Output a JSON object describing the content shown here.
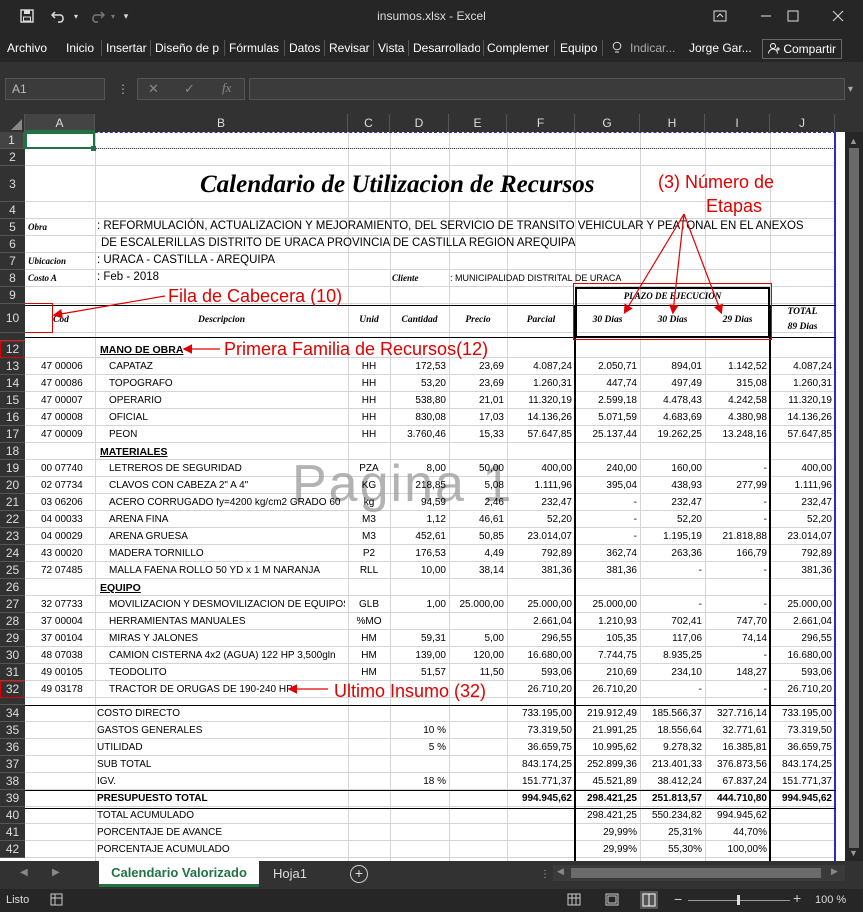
{
  "window": {
    "title": "insumos.xlsx - Excel",
    "user": "Jorge Gar...",
    "share": "Compartir"
  },
  "menu": [
    "Archivo",
    "Inicio",
    "Insertar",
    "Diseño de p",
    "Fórmulas",
    "Datos",
    "Revisar",
    "Vista",
    "Desarrollado",
    "Complemer",
    "Equipo",
    "Indicar..."
  ],
  "namebox": "A1",
  "fx": "fx",
  "columns": [
    "A",
    "B",
    "C",
    "D",
    "E",
    "F",
    "G",
    "H",
    "I",
    "J"
  ],
  "rows": [
    "1",
    "2",
    "3",
    "4",
    "5",
    "6",
    "7",
    "8",
    "9",
    "10",
    "12",
    "13",
    "14",
    "15",
    "16",
    "17",
    "18",
    "19",
    "20",
    "21",
    "22",
    "23",
    "24",
    "25",
    "26",
    "27",
    "28",
    "29",
    "30",
    "31",
    "32",
    "34",
    "35",
    "36",
    "37",
    "38",
    "39",
    "40",
    "41",
    "42"
  ],
  "sheet": {
    "title": "Calendario de Utilizacion de Recursos",
    "obra_label": "Obra",
    "obra_1": ": REFORMULACIÓN, ACTUALIZACION Y MEJORAMIENTO,  DEL SERVICIO  DE TRANSITO VEHICULAR  Y PEATONAL EN EL ANEXOS",
    "obra_2": "DE ESCALERILLAS DISTRITO DE  URACA       PROVINCIA DE CASTILLA  REGION AREQUIPA",
    "ubic_label": "Ubicacion",
    "ubic": ": URACA - CASTILLA - AREQUIPA",
    "costo_label": "Costo A",
    "costo": ": Feb - 2018",
    "cliente_label": "Cliente",
    "cliente": ": MUNICIPALIDAD DISTRITAL DE URACA",
    "plazo": "PLAZO DE EJECUCION",
    "h_cod": "Cod",
    "h_desc": "Descripcion",
    "h_unid": "Unid",
    "h_cant": "Cantidad",
    "h_precio": "Precio",
    "h_parcial": "Parcial",
    "h_g": "30 Dias",
    "h_h": "30 Dias",
    "h_i": "29 Dias",
    "h_total_1": "TOTAL",
    "h_total_2": "89 Dias",
    "watermark": "Pagina 1"
  },
  "data_rows": [
    {
      "row": "12",
      "b": "MANO DE OBRA",
      "section": true
    },
    {
      "row": "13",
      "a": "47 00006",
      "b": "CAPATAZ",
      "c": "HH",
      "d": "172,53",
      "e": "23,69",
      "f": "4.087,24",
      "g": "2.050,71",
      "h": "894,01",
      "i": "1.142,52",
      "j": "4.087,24"
    },
    {
      "row": "14",
      "a": "47 00086",
      "b": "TOPOGRAFO",
      "c": "HH",
      "d": "53,20",
      "e": "23,69",
      "f": "1.260,31",
      "g": "447,74",
      "h": "497,49",
      "i": "315,08",
      "j": "1.260,31"
    },
    {
      "row": "15",
      "a": "47 00007",
      "b": "OPERARIO",
      "c": "HH",
      "d": "538,80",
      "e": "21,01",
      "f": "11.320,19",
      "g": "2.599,18",
      "h": "4.478,43",
      "i": "4.242,58",
      "j": "11.320,19"
    },
    {
      "row": "16",
      "a": "47 00008",
      "b": "OFICIAL",
      "c": "HH",
      "d": "830,08",
      "e": "17,03",
      "f": "14.136,26",
      "g": "5.071,59",
      "h": "4.683,69",
      "i": "4.380,98",
      "j": "14.136,26"
    },
    {
      "row": "17",
      "a": "47 00009",
      "b": "PEON",
      "c": "HH",
      "d": "3.760,46",
      "e": "15,33",
      "f": "57.647,85",
      "g": "25.137,44",
      "h": "19.262,25",
      "i": "13.248,16",
      "j": "57.647,85"
    },
    {
      "row": "18",
      "b": "MATERIALES",
      "section": true
    },
    {
      "row": "19",
      "a": "00 07740",
      "b": "LETREROS DE SEGURIDAD",
      "c": "PZA",
      "d": "8,00",
      "e": "50,00",
      "f": "400,00",
      "g": "240,00",
      "h": "160,00",
      "i": "-",
      "j": "400,00"
    },
    {
      "row": "20",
      "a": "02 07734",
      "b": "CLAVOS CON CABEZA 2\" A 4\"",
      "c": "KG",
      "d": "218,85",
      "e": "5,08",
      "f": "1.111,96",
      "g": "395,04",
      "h": "438,93",
      "i": "277,99",
      "j": "1.111,96"
    },
    {
      "row": "21",
      "a": "03 06206",
      "b": "ACERO CORRUGADO fy=4200 kg/cm2 GRADO 60",
      "c": "kg",
      "d": "94,59",
      "e": "2,46",
      "f": "232,47",
      "g": "-",
      "h": "232,47",
      "i": "-",
      "j": "232,47"
    },
    {
      "row": "22",
      "a": "04 00033",
      "b": "ARENA FINA",
      "c": "M3",
      "d": "1,12",
      "e": "46,61",
      "f": "52,20",
      "g": "-",
      "h": "52,20",
      "i": "-",
      "j": "52,20"
    },
    {
      "row": "23",
      "a": "04 00029",
      "b": "ARENA GRUESA",
      "c": "M3",
      "d": "452,61",
      "e": "50,85",
      "f": "23.014,07",
      "g": "-",
      "h": "1.195,19",
      "i": "21.818,88",
      "j": "23.014,07"
    },
    {
      "row": "24",
      "a": "43 00020",
      "b": "MADERA TORNILLO",
      "c": "P2",
      "d": "176,53",
      "e": "4,49",
      "f": "792,89",
      "g": "362,74",
      "h": "263,36",
      "i": "166,79",
      "j": "792,89"
    },
    {
      "row": "25",
      "a": "72 07485",
      "b": "MALLA FAENA ROLLO 50 YD x 1 M NARANJA",
      "c": "RLL",
      "d": "10,00",
      "e": "38,14",
      "f": "381,36",
      "g": "381,36",
      "h": "-",
      "i": "-",
      "j": "381,36"
    },
    {
      "row": "26",
      "b": "EQUIPO",
      "section": true
    },
    {
      "row": "27",
      "a": "32 07733",
      "b": "MOVILIZACIÓN Y DESMOVILIZACIÓN DE EQUIPOS PES",
      "c": "GLB",
      "d": "1,00",
      "e": "25.000,00",
      "f": "25.000,00",
      "g": "25.000,00",
      "h": "-",
      "i": "-",
      "j": "25.000,00"
    },
    {
      "row": "28",
      "a": "37 00004",
      "b": "HERRAMIENTAS MANUALES",
      "c": "%MO",
      "d": "",
      "e": "",
      "f": "2.661,04",
      "g": "1.210,93",
      "h": "702,41",
      "i": "747,70",
      "j": "2.661,04"
    },
    {
      "row": "29",
      "a": "37 00104",
      "b": "MIRAS Y JALONES",
      "c": "HM",
      "d": "59,31",
      "e": "5,00",
      "f": "296,55",
      "g": "105,35",
      "h": "117,06",
      "i": "74,14",
      "j": "296,55"
    },
    {
      "row": "30",
      "a": "48 07038",
      "b": "CAMION CISTERNA 4x2 (AGUA) 122 HP 3,500gln",
      "c": "HM",
      "d": "139,00",
      "e": "120,00",
      "f": "16.680,00",
      "g": "7.744,75",
      "h": "8.935,25",
      "i": "-",
      "j": "16.680,00"
    },
    {
      "row": "31",
      "a": "49 00105",
      "b": "TEODOLITO",
      "c": "HM",
      "d": "51,57",
      "e": "11,50",
      "f": "593,06",
      "g": "210,69",
      "h": "234,10",
      "i": "148,27",
      "j": "593,06"
    },
    {
      "row": "32",
      "a": "49 03178",
      "b": "TRACTOR DE ORUGAS DE 190-240 HP",
      "c": "",
      "d": "",
      "e": "",
      "f": "26.710,20",
      "g": "26.710,20",
      "h": "-",
      "i": "-",
      "j": "26.710,20"
    },
    {
      "row": "34",
      "b": "COSTO DIRECTO",
      "f": "733.195,00",
      "g": "219.912,49",
      "h": "185.566,37",
      "i": "327.716,14",
      "j": "733.195,00"
    },
    {
      "row": "35",
      "b": "GASTOS GENERALES",
      "d": "10 %",
      "f": "73.319,50",
      "g": "21.991,25",
      "h": "18.556,64",
      "i": "32.771,61",
      "j": "73.319,50"
    },
    {
      "row": "36",
      "b": "UTILIDAD",
      "d": "5 %",
      "f": "36.659,75",
      "g": "10.995,62",
      "h": "9.278,32",
      "i": "16.385,81",
      "j": "36.659,75"
    },
    {
      "row": "37",
      "b": "SUB TOTAL",
      "f": "843.174,25",
      "g": "252.899,36",
      "h": "213.401,33",
      "i": "376.873,56",
      "j": "843.174,25"
    },
    {
      "row": "38",
      "b": "IGV.",
      "d": "18 %",
      "f": "151.771,37",
      "g": "45.521,89",
      "h": "38.412,24",
      "i": "67.837,24",
      "j": "151.771,37"
    },
    {
      "row": "39",
      "b": "PRESUPUESTO TOTAL",
      "f": "994.945,62",
      "g": "298.421,25",
      "h": "251.813,57",
      "i": "444.710,80",
      "j": "994.945,62",
      "bold": true
    },
    {
      "row": "40",
      "b": "TOTAL ACUMULADO",
      "g": "298.421,25",
      "h": "550.234,82",
      "i": "994.945,62"
    },
    {
      "row": "41",
      "b": "PORCENTAJE DE AVANCE",
      "g": "29,99%",
      "h": "25,31%",
      "i": "44,70%"
    },
    {
      "row": "42",
      "b": "PORCENTAJE ACUMULADO",
      "g": "29,99%",
      "h": "55,30%",
      "i": "100,00%"
    }
  ],
  "annotations": {
    "etapas_1": "(3) Número de",
    "etapas_2": "Etapas",
    "cabecera": "Fila de Cabecera (10)",
    "familia": "Primera Familia de Recursos(12)",
    "ultimo": "Ultimo Insumo (32)"
  },
  "tabs": [
    "Calendario Valorizado",
    "Hoja1"
  ],
  "status": {
    "ready": "Listo",
    "zoom": "100 %"
  },
  "colors": {
    "accent": "#217346",
    "annotation": "#e00000",
    "chrome": "#262626"
  }
}
